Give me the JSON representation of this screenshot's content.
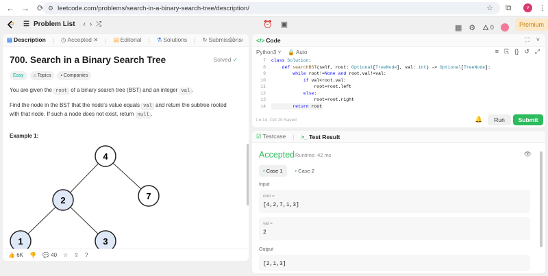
{
  "browser": {
    "url": "leetcode.com/problems/search-in-a-binary-search-tree/description/",
    "profile_initial": "v"
  },
  "header": {
    "problem_list": "Problem List",
    "streak_count": "0",
    "premium": "Premium"
  },
  "left_tabs": {
    "description": "Description",
    "accepted": "Accepted",
    "editorial": "Editorial",
    "solutions": "Solutions",
    "submissions": "Submissions"
  },
  "problem": {
    "title": "700. Search in a Binary Search Tree",
    "solved": "Solved",
    "difficulty": "Easy",
    "topics": "Topics",
    "companies": "Companies",
    "p1_a": "You are given the ",
    "p1_code1": "root",
    "p1_b": " of a binary search tree (BST) and an integer ",
    "p1_code2": "val",
    "p1_c": ".",
    "p2_a": "Find the node in the BST that the node's value equals ",
    "p2_code1": "val",
    "p2_b": " and return the subtree rooted with that node. If such a node does not exist, return ",
    "p2_code2": "null",
    "p2_c": ".",
    "example": "Example 1:",
    "tree_nodes": [
      "4",
      "2",
      "7",
      "1",
      "3"
    ],
    "highlight_color": "#dfe8f7"
  },
  "footer": {
    "likes": "6K",
    "comments": "40"
  },
  "code_panel": {
    "tab": "Code",
    "language": "Python3",
    "auto": "Auto",
    "status": "Ln 14, Col 20",
    "saved": "Saved",
    "run": "Run",
    "submit": "Submit",
    "line_numbers": [
      "7",
      "8",
      "9",
      "10",
      "11",
      "12",
      "13",
      "14"
    ],
    "lines": [
      "class Solution:",
      "    def searchBST(self, root: Optional[TreeNode], val: int) -> Optional[TreeNode]:",
      "        while root!=None and root.val!=val:",
      "            if val<root.val:",
      "                root=root.left",
      "            else:",
      "                root=root.right",
      "        return root"
    ]
  },
  "test_panel": {
    "testcase": "Testcase",
    "test_result": "Test Result",
    "verdict": "Accepted",
    "runtime": "Runtime: 42 ms",
    "case1": "Case 1",
    "case2": "Case 2",
    "input_label": "Input",
    "root_key": "root =",
    "root_value": "[4,2,7,1,3]",
    "val_key": "val =",
    "val_value": "2",
    "output_label": "Output",
    "output_value": "[2,1,3]"
  }
}
